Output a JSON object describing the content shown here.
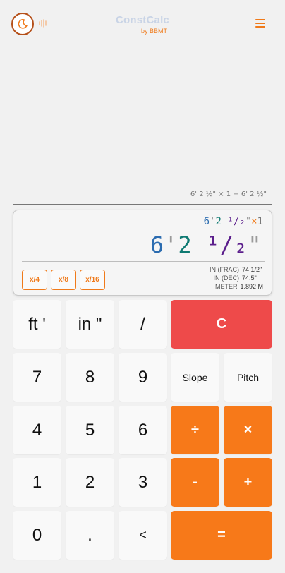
{
  "header": {
    "title": "ConstCalc",
    "subtitle": "by BBMT",
    "theme_icon": "moon-icon",
    "voice_icon": "soundwave-icon",
    "menu_icon": "hamburger-menu-icon"
  },
  "history": {
    "line": "6' 2 ½\" × 1 = 6' 2 ½\""
  },
  "display": {
    "expr": {
      "ft": "6",
      "ft_mark": "'",
      "inch": "2",
      "frac": "¹/₂",
      "in_mark": "\"",
      "op": "×",
      "num": "1"
    },
    "value": {
      "ft": "6",
      "ft_mark": "'",
      "inch": "2",
      "frac": "¹/₂",
      "in_mark": "\""
    },
    "mini_buttons": [
      "x/4",
      "x/8",
      "x/16"
    ],
    "conversions": [
      {
        "label": "IN (FRAC)",
        "value": "74 1/2\""
      },
      {
        "label": "IN (DEC)",
        "value": "74.5\""
      },
      {
        "label": "METER",
        "value": "1.892 M"
      }
    ]
  },
  "keys": {
    "ft": "ft '",
    "in": "in \"",
    "slash": "/",
    "clear": "C",
    "k7": "7",
    "k8": "8",
    "k9": "9",
    "slope": "Slope",
    "pitch": "Pitch",
    "k4": "4",
    "k5": "5",
    "k6": "6",
    "divide": "÷",
    "multiply": "×",
    "k1": "1",
    "k2": "2",
    "k3": "3",
    "minus": "-",
    "plus": "+",
    "k0": "0",
    "dot": ".",
    "back": "<",
    "equals": "="
  },
  "colors": {
    "accent": "#f77919",
    "clear": "#ee4a4a",
    "feet": "#2b6cb0",
    "inches": "#0f7a72",
    "fraction": "#5b1e8c"
  }
}
